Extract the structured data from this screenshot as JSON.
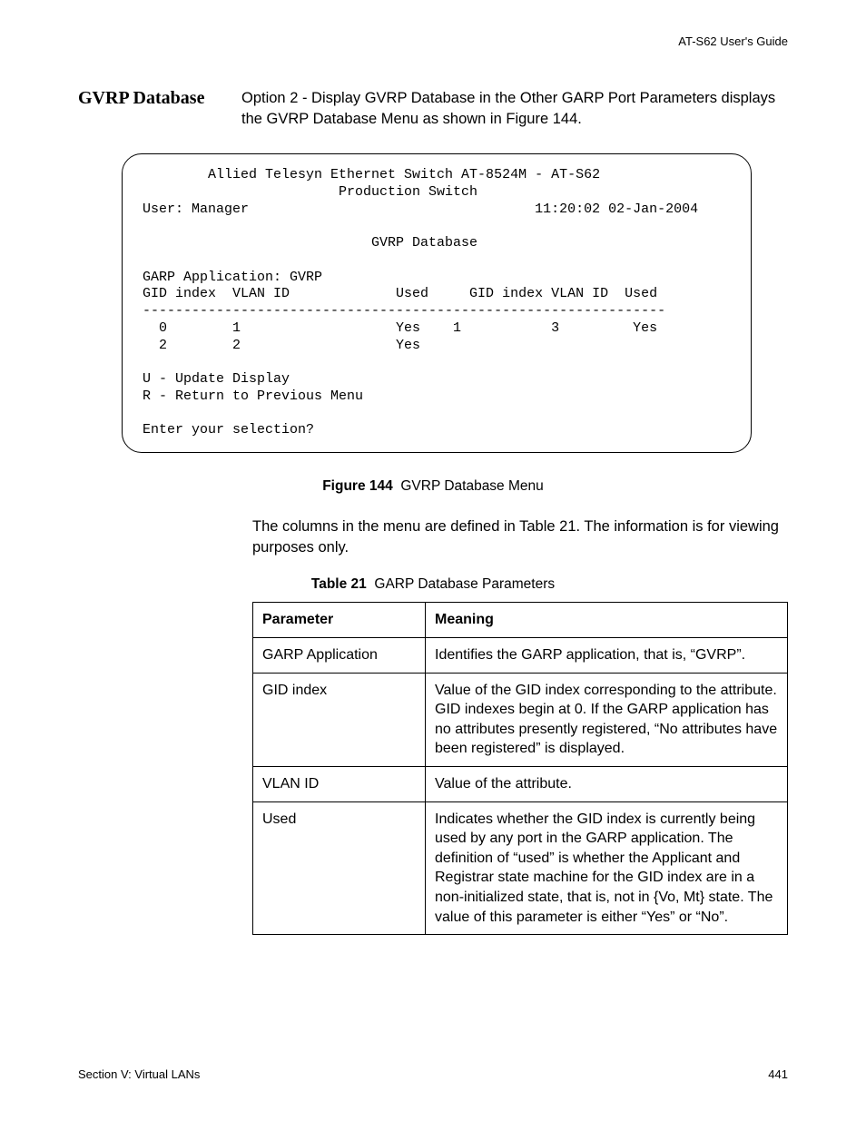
{
  "header": {
    "doc_title": "AT-S62 User's Guide"
  },
  "section": {
    "heading": "GVRP Database",
    "body": "Option 2 - Display GVRP Database in the Other GARP Port Parameters displays the GVRP Database Menu as shown in Figure 144."
  },
  "terminal": {
    "line1": "Allied Telesyn Ethernet Switch AT-8524M - AT-S62",
    "line2": "Production Switch",
    "user_label": "User: Manager",
    "timestamp": "11:20:02 02-Jan-2004",
    "title": "GVRP Database",
    "garp_app": "GARP Application: GVRP",
    "cols": {
      "gid_index": "GID index",
      "vlan_id": "VLAN ID",
      "used": "Used"
    },
    "divider": "----------------------------------------------------------------",
    "rows": [
      {
        "gid": "0",
        "vlan": "1",
        "used": "Yes",
        "gid2": "1",
        "vlan2": "3",
        "used2": "Yes"
      },
      {
        "gid": "2",
        "vlan": "2",
        "used": "Yes",
        "gid2": "",
        "vlan2": "",
        "used2": ""
      }
    ],
    "option_u": "U - Update Display",
    "option_r": "R - Return to Previous Menu",
    "prompt": "Enter your selection?"
  },
  "figure": {
    "label": "Figure 144",
    "title": "GVRP Database Menu"
  },
  "post_figure": "The columns in the menu are defined in Table 21. The information is for viewing purposes only.",
  "table_caption": {
    "label": "Table 21",
    "title": "GARP Database Parameters"
  },
  "table": {
    "headers": {
      "parameter": "Parameter",
      "meaning": "Meaning"
    },
    "rows": [
      {
        "parameter": "GARP Application",
        "meaning": "Identifies the GARP application, that is, “GVRP”."
      },
      {
        "parameter": "GID index",
        "meaning": "Value of the GID index corresponding to the attribute. GID indexes begin at 0. If the GARP application has no attributes presently registered, “No attributes have been registered” is displayed."
      },
      {
        "parameter": "VLAN ID",
        "meaning": "Value of the attribute."
      },
      {
        "parameter": "Used",
        "meaning": "Indicates whether the GID index is currently being used by any port in the GARP application. The definition of “used” is whether the Applicant and Registrar state machine for the GID index are in a non-initialized state, that is, not in {Vo, Mt} state. The value of this parameter is either “Yes” or “No”."
      }
    ]
  },
  "footer": {
    "left": "Section V: Virtual LANs",
    "right": "441"
  }
}
